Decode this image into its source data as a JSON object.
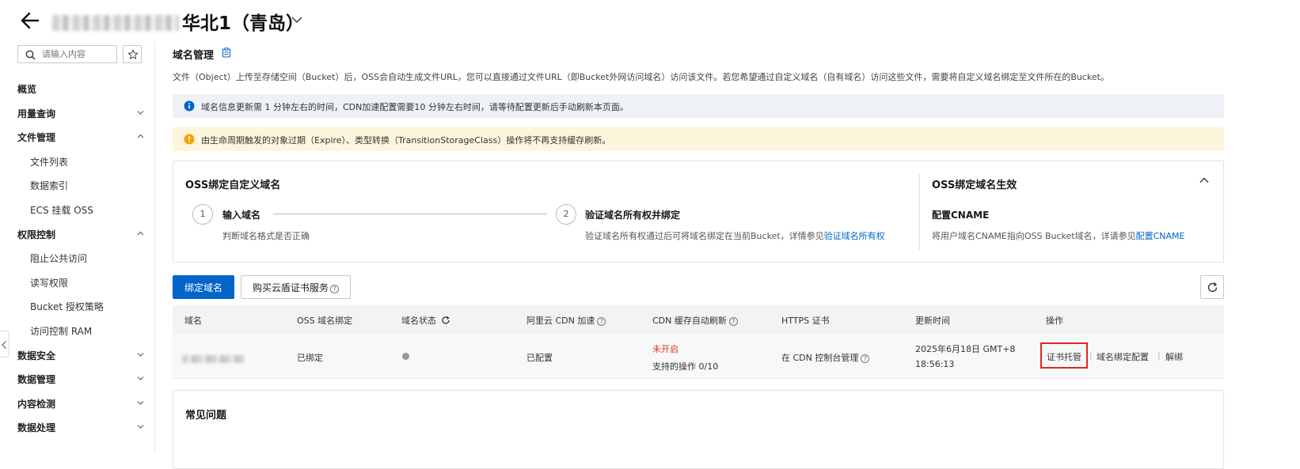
{
  "header": {
    "title_suffix": "华北1（青岛）"
  },
  "sidebar": {
    "search_placeholder": "请输入内容",
    "items": [
      {
        "label": "概览",
        "level": "top",
        "chevron": ""
      },
      {
        "label": "用量查询",
        "level": "top",
        "chevron": "down"
      },
      {
        "label": "文件管理",
        "level": "top",
        "chevron": "up"
      },
      {
        "label": "文件列表",
        "level": "sub",
        "chevron": ""
      },
      {
        "label": "数据索引",
        "level": "sub",
        "chevron": ""
      },
      {
        "label": "ECS 挂载 OSS",
        "level": "sub",
        "chevron": ""
      },
      {
        "label": "权限控制",
        "level": "top",
        "chevron": "up"
      },
      {
        "label": "阻止公共访问",
        "level": "sub",
        "chevron": ""
      },
      {
        "label": "读写权限",
        "level": "sub",
        "chevron": ""
      },
      {
        "label": "Bucket 授权策略",
        "level": "sub",
        "chevron": ""
      },
      {
        "label": "访问控制 RAM",
        "level": "sub",
        "chevron": ""
      },
      {
        "label": "数据安全",
        "level": "top",
        "chevron": "down"
      },
      {
        "label": "数据管理",
        "level": "top",
        "chevron": "down"
      },
      {
        "label": "内容检测",
        "level": "top",
        "chevron": "down"
      },
      {
        "label": "数据处理",
        "level": "top",
        "chevron": "down"
      }
    ]
  },
  "main": {
    "heading": "域名管理",
    "description": "文件（Object）上传至存储空间（Bucket）后，OSS会自动生成文件URL，您可以直接通过文件URL（即Bucket外网访问域名）访问该文件。若您希望通过自定义域名（自有域名）访问这些文件，需要将自定义域名绑定至文件所在的Bucket。",
    "info_alert": "域名信息更新需 1 分钟左右的时间，CDN加速配置需要10 分钟左右时间，请等待配置更新后手动刷新本页面。",
    "warn_alert": "由生命周期触发的对象过期（Expire）、类型转换（TransitionStorageClass）操作将不再支持缓存刷新。",
    "steps": {
      "title": "OSS绑定自定义域名",
      "step1_num": "1",
      "step1_name": "输入域名",
      "step1_desc": "判断域名格式是否正确",
      "step2_num": "2",
      "step2_name": "验证域名所有权并绑定",
      "step2_desc": "验证域名所有权通过后可将域名绑定在当前Bucket，详情参见",
      "step2_link": "验证域名所有权",
      "right_title": "OSS绑定域名生效",
      "right_name": "配置CNAME",
      "right_desc": "将用户域名CNAME指向OSS Bucket域名，详请参见",
      "right_link": "配置CNAME"
    },
    "buttons": {
      "bind": "绑定域名",
      "buy_cert": "购买云盾证书服务"
    },
    "table": {
      "columns": [
        "域名",
        "OSS 域名绑定",
        "域名状态",
        "阿里云 CDN 加速",
        "CDN 缓存自动刷新",
        "HTTPS 证书",
        "更新时间",
        "操作"
      ],
      "row": {
        "oss_bind": "已绑定",
        "cdn": "已配置",
        "cache_status": "未开启",
        "cache_link": "支持的操作 0/10",
        "https": "在 CDN 控制台管理",
        "updated_line1": "2025年6月18日 GMT+8",
        "updated_line2": "18:56:13",
        "action_cert": "证书托管",
        "action_config": "域名绑定配置",
        "action_unbind": "解绑"
      }
    },
    "faq_title": "常见问题"
  },
  "colors": {
    "primary": "#0064c8",
    "warning": "#f0a500",
    "danger": "#e23b18",
    "highlight_box": "#e0281e"
  }
}
